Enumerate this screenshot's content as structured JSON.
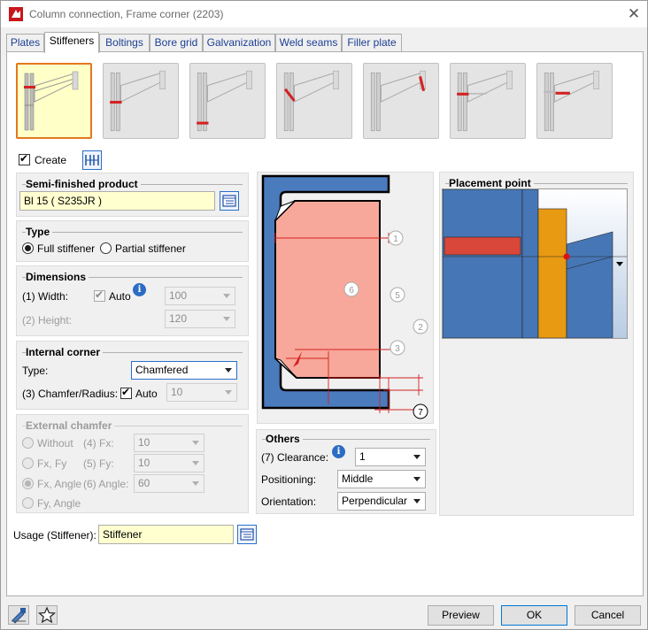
{
  "window": {
    "title": "Column connection, Frame corner (2203)"
  },
  "tabs": [
    "Plates",
    "Stiffeners",
    "Boltings",
    "Bore grid",
    "Galvanization",
    "Weld seams",
    "Filler plate"
  ],
  "create": {
    "label": "Create",
    "checked": true
  },
  "semi_finished": {
    "title": "Semi-finished product",
    "value": "Bl 15  ( S235JR )"
  },
  "type_group": {
    "title": "Type",
    "full": "Full stiffener",
    "partial": "Partial stiffener"
  },
  "dimensions": {
    "title": "Dimensions",
    "width_label": "(1) Width:",
    "auto_label": "Auto",
    "width_value": "100",
    "height_label": "(2) Height:",
    "height_value": "120"
  },
  "internal_corner": {
    "title": "Internal corner",
    "type_label": "Type:",
    "type_value": "Chamfered",
    "chamfer_label": "(3) Chamfer/Radius:",
    "auto_label": "Auto",
    "chamfer_value": "10"
  },
  "external_chamfer": {
    "title": "External chamfer",
    "without": "Without",
    "fx_fy": "Fx, Fy",
    "fx_angle": "Fx, Angle",
    "fy_angle": "Fy, Angle",
    "fx_label": "(4) Fx:",
    "fx_value": "10",
    "fy_label": "(5) Fy:",
    "fy_value": "10",
    "angle_label": "(6) Angle:",
    "angle_value": "60"
  },
  "others": {
    "title": "Others",
    "clearance_label": "(7) Clearance:",
    "clearance_value": "1",
    "positioning_label": "Positioning:",
    "positioning_value": "Middle",
    "orientation_label": "Orientation:",
    "orientation_value": "Perpendicular"
  },
  "placement": {
    "title": "Placement point"
  },
  "diagram": {
    "labels": [
      "1",
      "2",
      "3",
      "5",
      "6",
      "7"
    ]
  },
  "usage": {
    "label": "Usage (Stiffener):",
    "value": "Stiffener"
  },
  "buttons": {
    "preview": "Preview",
    "ok": "OK",
    "cancel": "Cancel"
  },
  "colors": {
    "accent_selected": "#e3781f",
    "stiffener_red": "#d32222",
    "steel_blue": "#4676b5",
    "plate_orange": "#e89a12",
    "salmon": "#f7a89a"
  }
}
